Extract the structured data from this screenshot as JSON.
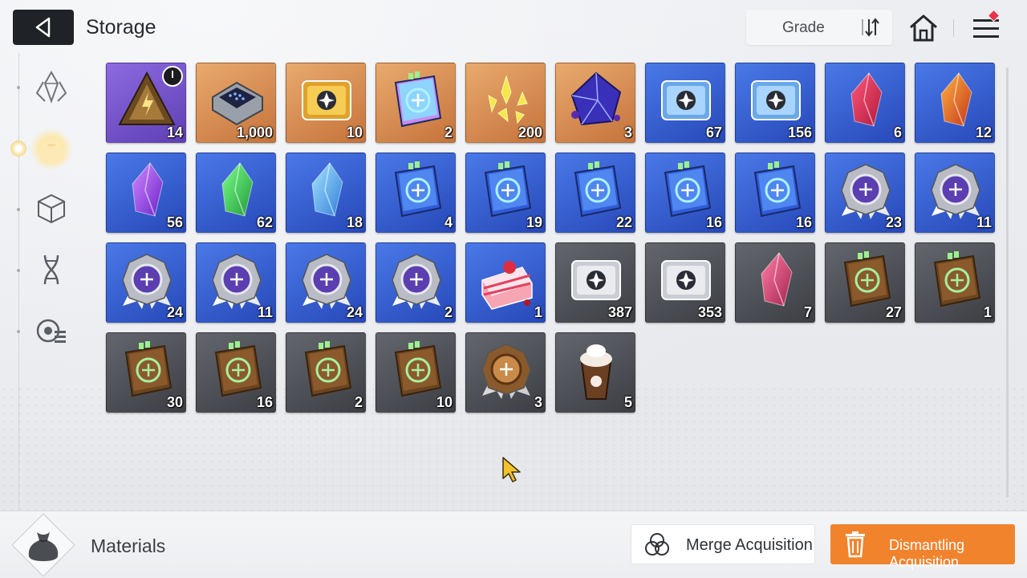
{
  "header": {
    "title": "Storage",
    "sort_label": "Grade"
  },
  "sidebar": {
    "items": [
      {
        "icon": "crystal-icon",
        "active": false
      },
      {
        "icon": "pouch-icon",
        "active": true
      },
      {
        "icon": "cube-icon",
        "active": false
      },
      {
        "icon": "dna-icon",
        "active": false
      },
      {
        "icon": "chip-list-icon",
        "active": false
      }
    ]
  },
  "items": [
    {
      "name": "pyramid-module",
      "grade": "purple",
      "qty": "14",
      "timer": true
    },
    {
      "name": "data-chip",
      "grade": "orange",
      "qty": "1,000"
    },
    {
      "name": "gold-ticket",
      "grade": "orange",
      "qty": "10"
    },
    {
      "name": "rainbow-manual",
      "grade": "orange",
      "qty": "2"
    },
    {
      "name": "gold-shards",
      "grade": "orange",
      "qty": "200"
    },
    {
      "name": "void-cube",
      "grade": "orange",
      "qty": "3"
    },
    {
      "name": "portrait-ticket",
      "grade": "blue",
      "qty": "67"
    },
    {
      "name": "star-ticket",
      "grade": "blue",
      "qty": "156"
    },
    {
      "name": "red-crystal",
      "grade": "blue",
      "qty": "6"
    },
    {
      "name": "fire-crystal",
      "grade": "blue",
      "qty": "12"
    },
    {
      "name": "purple-crystal",
      "grade": "blue",
      "qty": "56"
    },
    {
      "name": "green-crystal",
      "grade": "blue",
      "qty": "62"
    },
    {
      "name": "ice-crystal",
      "grade": "blue",
      "qty": "18"
    },
    {
      "name": "blue-manual-swords",
      "grade": "blue",
      "qty": "4"
    },
    {
      "name": "blue-manual-eye",
      "grade": "blue",
      "qty": "19"
    },
    {
      "name": "blue-manual-wings",
      "grade": "blue",
      "qty": "22"
    },
    {
      "name": "blue-manual-bolt",
      "grade": "blue",
      "qty": "16"
    },
    {
      "name": "blue-manual-orb",
      "grade": "blue",
      "qty": "16"
    },
    {
      "name": "medal-sword",
      "grade": "blue",
      "qty": "23"
    },
    {
      "name": "medal-shield",
      "grade": "blue",
      "qty": "11"
    },
    {
      "name": "medal-eye",
      "grade": "blue",
      "qty": "24"
    },
    {
      "name": "medal-wings",
      "grade": "blue",
      "qty": "11"
    },
    {
      "name": "medal-bolt",
      "grade": "blue",
      "qty": "24"
    },
    {
      "name": "medal-orb",
      "grade": "blue",
      "qty": "2"
    },
    {
      "name": "strawberry-cake",
      "grade": "blue",
      "qty": "1"
    },
    {
      "name": "silver-portrait-ticket",
      "grade": "gray",
      "qty": "387"
    },
    {
      "name": "silver-star-ticket",
      "grade": "gray",
      "qty": "353"
    },
    {
      "name": "pink-crystal",
      "grade": "gray",
      "qty": "7"
    },
    {
      "name": "brown-manual-swords",
      "grade": "gray",
      "qty": "27"
    },
    {
      "name": "brown-manual-shield",
      "grade": "gray",
      "qty": "1"
    },
    {
      "name": "brown-manual-eye",
      "grade": "gray",
      "qty": "30"
    },
    {
      "name": "brown-manual-wings",
      "grade": "gray",
      "qty": "16"
    },
    {
      "name": "brown-manual-bolt",
      "grade": "gray",
      "qty": "2"
    },
    {
      "name": "brown-manual-orb",
      "grade": "gray",
      "qty": "10"
    },
    {
      "name": "bronze-medal-bolt",
      "grade": "gray",
      "qty": "3"
    },
    {
      "name": "chocolate-shake",
      "grade": "gray",
      "qty": "5"
    }
  ],
  "footer": {
    "category": "Materials",
    "merge_label": "Merge Acquisition",
    "dismantle_label": "Dismantling Acquisition"
  },
  "colors": {
    "accent": "#f2832d",
    "purple": "#7a57d1",
    "orange": "#d9904f",
    "blue": "#3761d6",
    "gray": "#505359"
  }
}
